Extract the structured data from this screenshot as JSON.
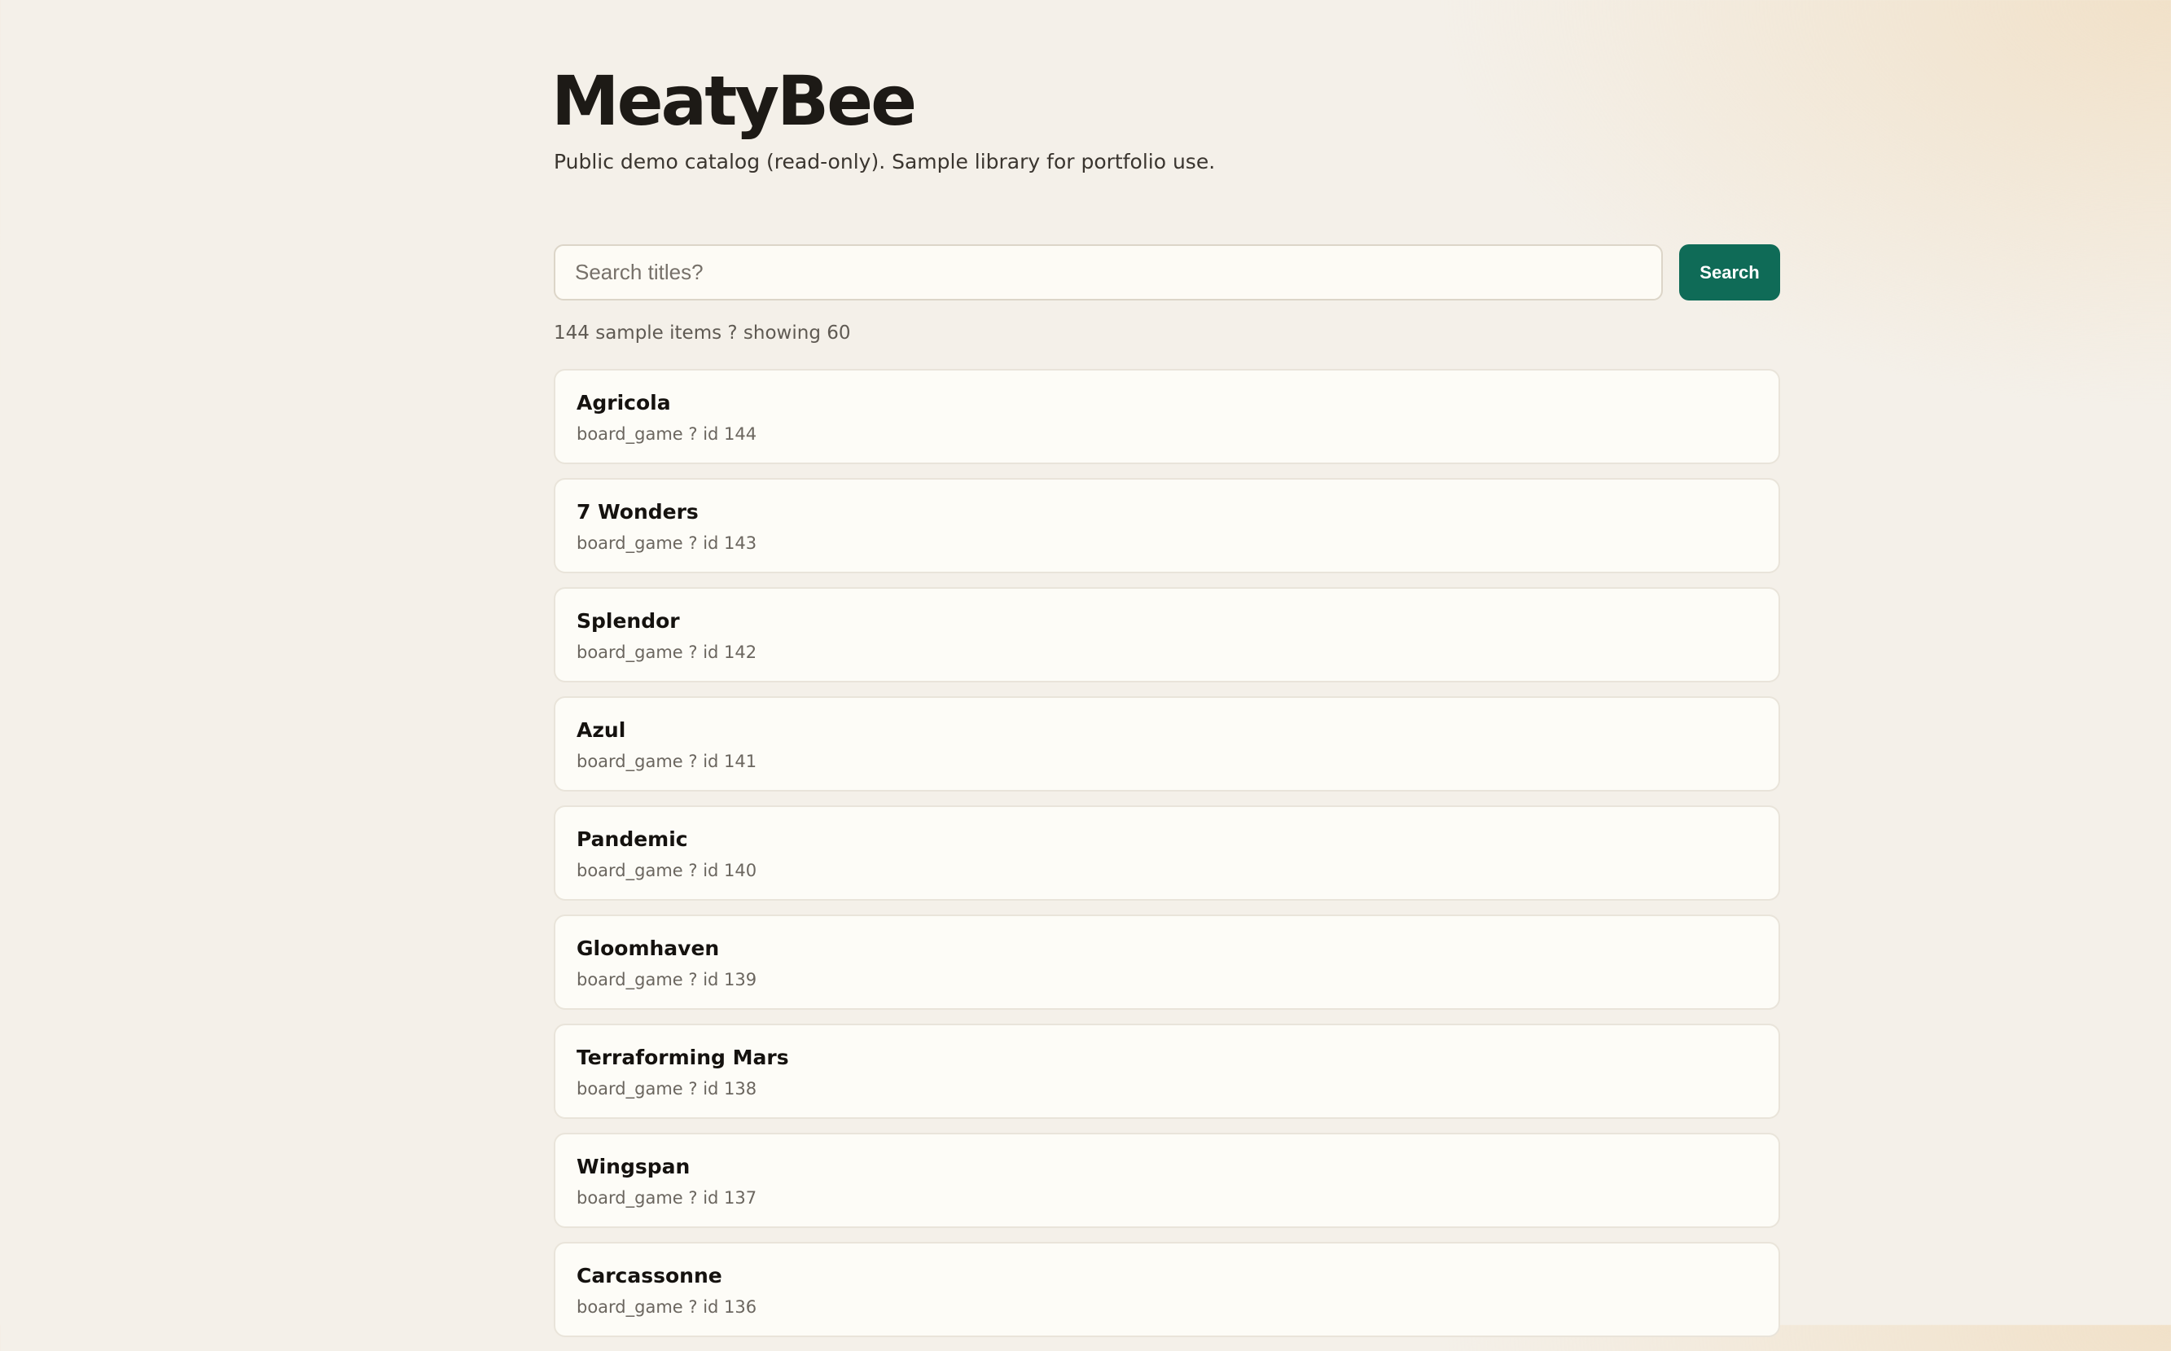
{
  "header": {
    "title": "MeatyBee",
    "subtitle": "Public demo catalog (read-only). Sample library for portfolio use."
  },
  "search": {
    "placeholder": "Search titles?",
    "value": "",
    "button_label": "Search"
  },
  "summary": {
    "count_text": "144 sample items ? showing 60"
  },
  "items": [
    {
      "title": "Agricola",
      "meta": "board_game ? id 144"
    },
    {
      "title": "7 Wonders",
      "meta": "board_game ? id 143"
    },
    {
      "title": "Splendor",
      "meta": "board_game ? id 142"
    },
    {
      "title": "Azul",
      "meta": "board_game ? id 141"
    },
    {
      "title": "Pandemic",
      "meta": "board_game ? id 140"
    },
    {
      "title": "Gloomhaven",
      "meta": "board_game ? id 139"
    },
    {
      "title": "Terraforming Mars",
      "meta": "board_game ? id 138"
    },
    {
      "title": "Wingspan",
      "meta": "board_game ? id 137"
    },
    {
      "title": "Carcassonne",
      "meta": "board_game ? id 136"
    }
  ],
  "colors": {
    "background": "#f4f0e9",
    "accent": "#0f6b57",
    "card": "#fdfcf7"
  }
}
